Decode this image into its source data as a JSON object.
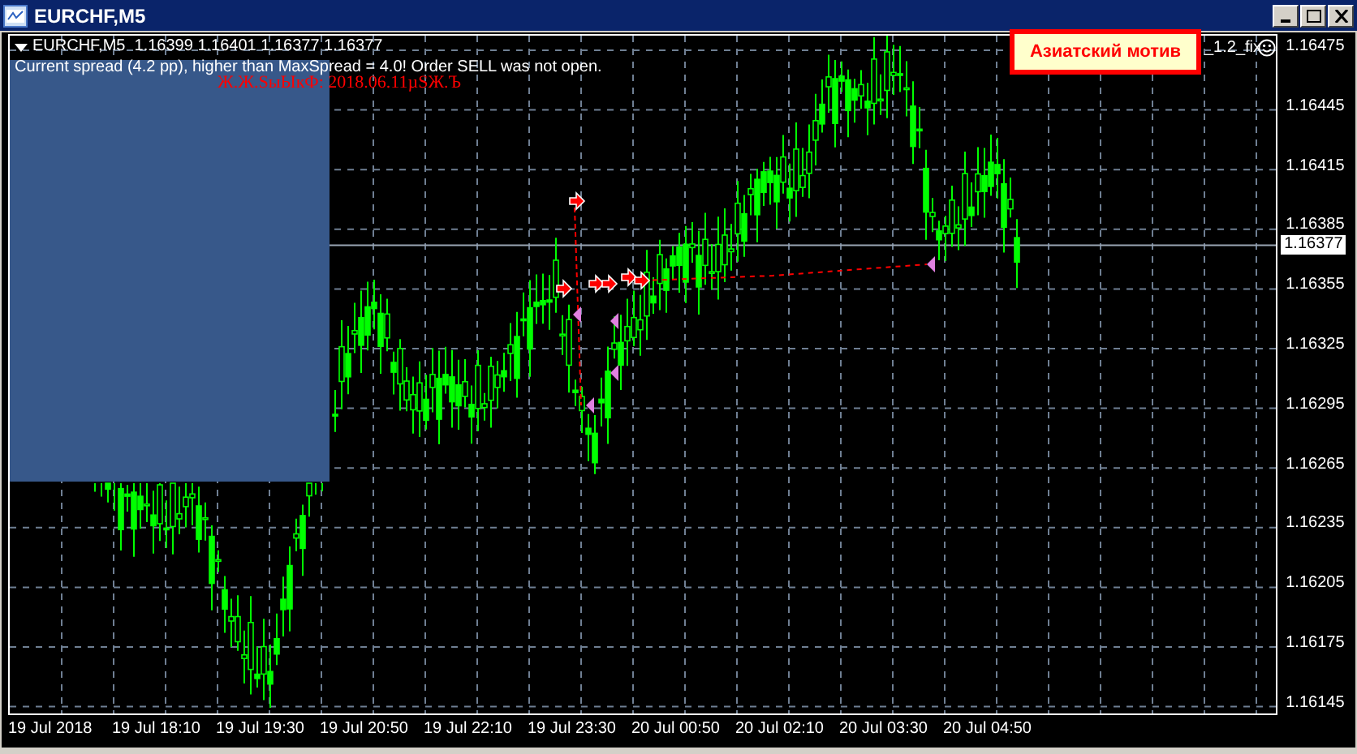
{
  "window": {
    "title": "EURCHF,M5"
  },
  "chart": {
    "header": "EURCHF,M5  1.16399 1.16401 1.16377 1.16377",
    "message": "Current spread (4.2 pp), higher than MaxSpread = 4.0! Order SELL was not open.",
    "garbled_text": "Ж.Ж.SыЫкФ: 2018.06.11µSЖ.Ъ",
    "indicator_label": "Азиатский мотив",
    "expert_name": "_1.2_fix",
    "price_labels": [
      "1.16475",
      "1.16445",
      "1.16415",
      "1.16385",
      "1.16355",
      "1.16325",
      "1.16295",
      "1.16265",
      "1.16235",
      "1.16205",
      "1.16175",
      "1.16145"
    ],
    "current_price": "1.16377",
    "time_labels": [
      "19 Jul 2018",
      "19 Jul 18:10",
      "19 Jul 19:30",
      "19 Jul 20:50",
      "19 Jul 22:10",
      "19 Jul 23:30",
      "20 Jul 00:50",
      "20 Jul 02:10",
      "20 Jul 03:30",
      "20 Jul 04:50"
    ]
  }
}
